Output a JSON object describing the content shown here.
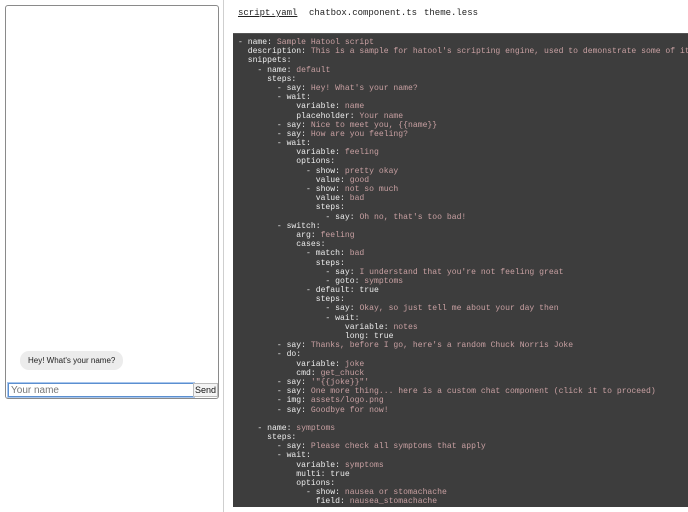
{
  "chat": {
    "messages": [
      "Hey! What's your name?"
    ],
    "input_placeholder": "Your name",
    "input_value": "",
    "send_label": "Send"
  },
  "tabs": [
    {
      "label": "script.yaml",
      "active": true
    },
    {
      "label": "chatbox.component.ts",
      "active": false
    },
    {
      "label": "theme.less",
      "active": false
    }
  ],
  "colors": {
    "code_bg": "#3d3d3d",
    "code_key": "#ececec",
    "code_value": "#c8a0a2",
    "input_border": "#5b8fd0"
  },
  "code_lines": [
    {
      "k": "- name: ",
      "v": "Sample Hatool script"
    },
    {
      "k": "  description: ",
      "v": "This is a sample for hatool's scripting engine, used to demonstrate some of it"
    },
    {
      "k": "  snippets:",
      "v": ""
    },
    {
      "k": "    - name: ",
      "v": "default"
    },
    {
      "k": "      steps:",
      "v": ""
    },
    {
      "k": "        - say: ",
      "v": "Hey! What's your name?"
    },
    {
      "k": "        - wait:",
      "v": ""
    },
    {
      "k": "            variable: ",
      "v": "name"
    },
    {
      "k": "            placeholder: ",
      "v": "Your name"
    },
    {
      "k": "        - say: ",
      "v": "Nice to meet you, {{name}}"
    },
    {
      "k": "        - say: ",
      "v": "How are you feeling?"
    },
    {
      "k": "        - wait:",
      "v": ""
    },
    {
      "k": "            variable: ",
      "v": "feeling"
    },
    {
      "k": "            options:",
      "v": ""
    },
    {
      "k": "              - show: ",
      "v": "pretty okay"
    },
    {
      "k": "                value: ",
      "v": "good"
    },
    {
      "k": "              - show: ",
      "v": "not so much"
    },
    {
      "k": "                value: ",
      "v": "bad"
    },
    {
      "k": "                steps:",
      "v": ""
    },
    {
      "k": "                  - say: ",
      "v": "Oh no, that's too bad!"
    },
    {
      "k": "        - switch:",
      "v": ""
    },
    {
      "k": "            arg: ",
      "v": "feeling"
    },
    {
      "k": "            cases:",
      "v": ""
    },
    {
      "k": "              - match: ",
      "v": "bad"
    },
    {
      "k": "                steps:",
      "v": ""
    },
    {
      "k": "                  - say: ",
      "v": "I understand that you're not feeling great"
    },
    {
      "k": "                  - goto: ",
      "v": "symptoms"
    },
    {
      "k": "              - default: true",
      "v": ""
    },
    {
      "k": "                steps:",
      "v": ""
    },
    {
      "k": "                  - say: ",
      "v": "Okay, so just tell me about your day then"
    },
    {
      "k": "                  - wait:",
      "v": ""
    },
    {
      "k": "                      variable: ",
      "v": "notes"
    },
    {
      "k": "                      long: true",
      "v": ""
    },
    {
      "k": "        - say: ",
      "v": "Thanks, before I go, here's a random Chuck Norris Joke"
    },
    {
      "k": "        - do:",
      "v": ""
    },
    {
      "k": "            variable: ",
      "v": "joke"
    },
    {
      "k": "            cmd: ",
      "v": "get_chuck"
    },
    {
      "k": "        - say: ",
      "v": "'\"{{joke}}\"'"
    },
    {
      "k": "        - say: ",
      "v": "One more thing... here is a custom chat component (click it to proceed)"
    },
    {
      "k": "        - img: ",
      "v": "assets/logo.png"
    },
    {
      "k": "        - say: ",
      "v": "Goodbye for now!"
    },
    {
      "k": "",
      "v": ""
    },
    {
      "k": "    - name: ",
      "v": "symptoms"
    },
    {
      "k": "      steps:",
      "v": ""
    },
    {
      "k": "        - say: ",
      "v": "Please check all symptoms that apply"
    },
    {
      "k": "        - wait:",
      "v": ""
    },
    {
      "k": "            variable: ",
      "v": "symptoms"
    },
    {
      "k": "            multi: true",
      "v": ""
    },
    {
      "k": "            options:",
      "v": ""
    },
    {
      "k": "              - show: ",
      "v": "nausea or stomachache"
    },
    {
      "k": "                field: ",
      "v": "nausea_stomachache"
    }
  ]
}
